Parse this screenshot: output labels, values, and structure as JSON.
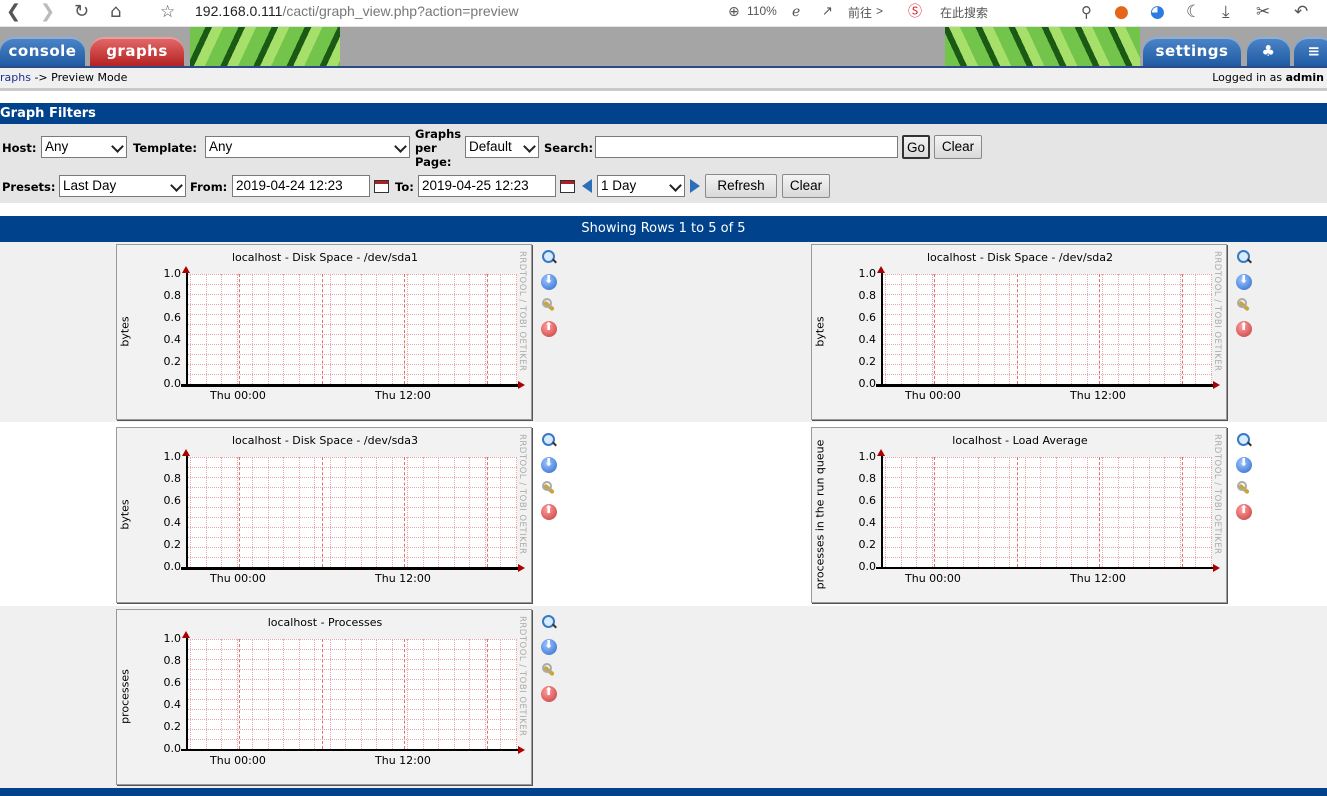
{
  "browser": {
    "url_host": "192.168.0.111",
    "url_path": "/cacti/graph_view.php?action=preview",
    "zoom": "110%",
    "goto_label": "前往",
    "search_label": "在此搜索"
  },
  "nav": {
    "tabs": {
      "console": "console",
      "graphs": "graphs",
      "settings": "settings"
    },
    "breadcrumb_link": "raphs",
    "breadcrumb_rest": "-> Preview Mode",
    "logged_in_prefix": "Logged in as",
    "user": "admin"
  },
  "filters": {
    "header": "Graph Filters",
    "host_label": "Host:",
    "host_value": "Any",
    "template_label": "Template:",
    "template_value": "Any",
    "graphs_per_page_label_1": "Graphs",
    "graphs_per_page_label_2": "per",
    "graphs_per_page_label_3": "Page:",
    "graphs_per_page_value": "Default",
    "search_label": "Search:",
    "search_value": "",
    "go_label": "Go",
    "clear_label": "Clear",
    "presets_label": "Presets:",
    "presets_value": "Last Day",
    "from_label": "From:",
    "from_value": "2019-04-24 12:23",
    "to_label": "To:",
    "to_value": "2019-04-25 12:23",
    "timespan_value": "1 Day",
    "refresh_label": "Refresh",
    "clear2_label": "Clear"
  },
  "rows_header": "Showing Rows 1 to 5 of 5",
  "graphs": [
    {
      "title": "localhost - Disk Space - /dev/sda1",
      "ylabel": "bytes",
      "flatline": true
    },
    {
      "title": "localhost - Disk Space - /dev/sda2",
      "ylabel": "bytes",
      "flatline": true
    },
    {
      "title": "localhost - Disk Space - /dev/sda3",
      "ylabel": "bytes",
      "flatline": true
    },
    {
      "title": "localhost - Load Average",
      "ylabel": "processes in the run queue",
      "flatline": false
    },
    {
      "title": "localhost - Processes",
      "ylabel": "processes",
      "flatline": false
    }
  ],
  "graph_common": {
    "yticks": [
      "1.0",
      "0.8",
      "0.6",
      "0.4",
      "0.2",
      "0.0"
    ],
    "xticks": [
      "Thu 00:00",
      "Thu 12:00"
    ],
    "vendor": "RRDTOOL / TOBI OETIKER"
  },
  "chart_data": [
    {
      "type": "line",
      "title": "localhost - Disk Space - /dev/sda1",
      "ylabel": "bytes",
      "xlabel": "",
      "ylim": [
        0,
        1.0
      ],
      "x": [
        "Thu 00:00",
        "Thu 12:00"
      ],
      "series": []
    },
    {
      "type": "line",
      "title": "localhost - Disk Space - /dev/sda2",
      "ylabel": "bytes",
      "xlabel": "",
      "ylim": [
        0,
        1.0
      ],
      "x": [
        "Thu 00:00",
        "Thu 12:00"
      ],
      "series": []
    },
    {
      "type": "line",
      "title": "localhost - Disk Space - /dev/sda3",
      "ylabel": "bytes",
      "xlabel": "",
      "ylim": [
        0,
        1.0
      ],
      "x": [
        "Thu 00:00",
        "Thu 12:00"
      ],
      "series": []
    },
    {
      "type": "line",
      "title": "localhost - Load Average",
      "ylabel": "processes in the run queue",
      "xlabel": "",
      "ylim": [
        0,
        1.0
      ],
      "x": [
        "Thu 00:00",
        "Thu 12:00"
      ],
      "series": []
    },
    {
      "type": "line",
      "title": "localhost - Processes",
      "ylabel": "processes",
      "xlabel": "",
      "ylim": [
        0,
        1.0
      ],
      "x": [
        "Thu 00:00",
        "Thu 12:00"
      ],
      "series": []
    }
  ]
}
